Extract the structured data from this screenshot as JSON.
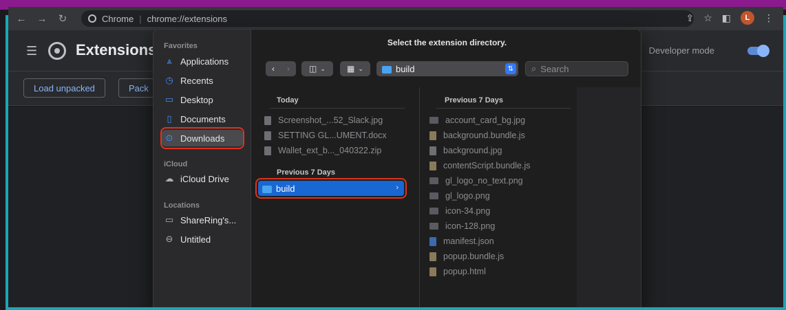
{
  "browser": {
    "site_label": "Chrome",
    "url": "chrome://extensions",
    "avatar_letter": "L"
  },
  "extensions": {
    "title": "Extensions",
    "developer_mode_label": "Developer mode",
    "load_unpacked_label": "Load unpacked",
    "pack_label": "Pack"
  },
  "dialog": {
    "title": "Select the extension directory.",
    "path_value": "build",
    "search_placeholder": "Search",
    "sidebar": {
      "favorites_header": "Favorites",
      "favorites": [
        {
          "label": "Applications",
          "icon": "applications-icon"
        },
        {
          "label": "Recents",
          "icon": "clock-icon"
        },
        {
          "label": "Desktop",
          "icon": "desktop-icon"
        },
        {
          "label": "Documents",
          "icon": "document-icon"
        },
        {
          "label": "Downloads",
          "icon": "download-icon"
        }
      ],
      "icloud_header": "iCloud",
      "icloud": [
        {
          "label": "iCloud Drive",
          "icon": "cloud-icon"
        }
      ],
      "locations_header": "Locations",
      "locations": [
        {
          "label": "ShareRing's...",
          "icon": "laptop-icon"
        },
        {
          "label": "Untitled",
          "icon": "drive-icon"
        }
      ]
    },
    "column1": {
      "today_header": "Today",
      "today_files": [
        "Screenshot_...52_Slack.jpg",
        "SETTING GL...UMENT.docx",
        "Wallet_ext_b..._040322.zip"
      ],
      "prev_header": "Previous 7 Days",
      "selected_folder": "build"
    },
    "column2": {
      "header": "Previous 7 Days",
      "files": [
        "account_card_bg.jpg",
        "background.bundle.js",
        "background.jpg",
        "contentScript.bundle.js",
        "gl_logo_no_text.png",
        "gl_logo.png",
        "icon-34.png",
        "icon-128.png",
        "manifest.json",
        "popup.bundle.js",
        "popup.html"
      ]
    }
  }
}
